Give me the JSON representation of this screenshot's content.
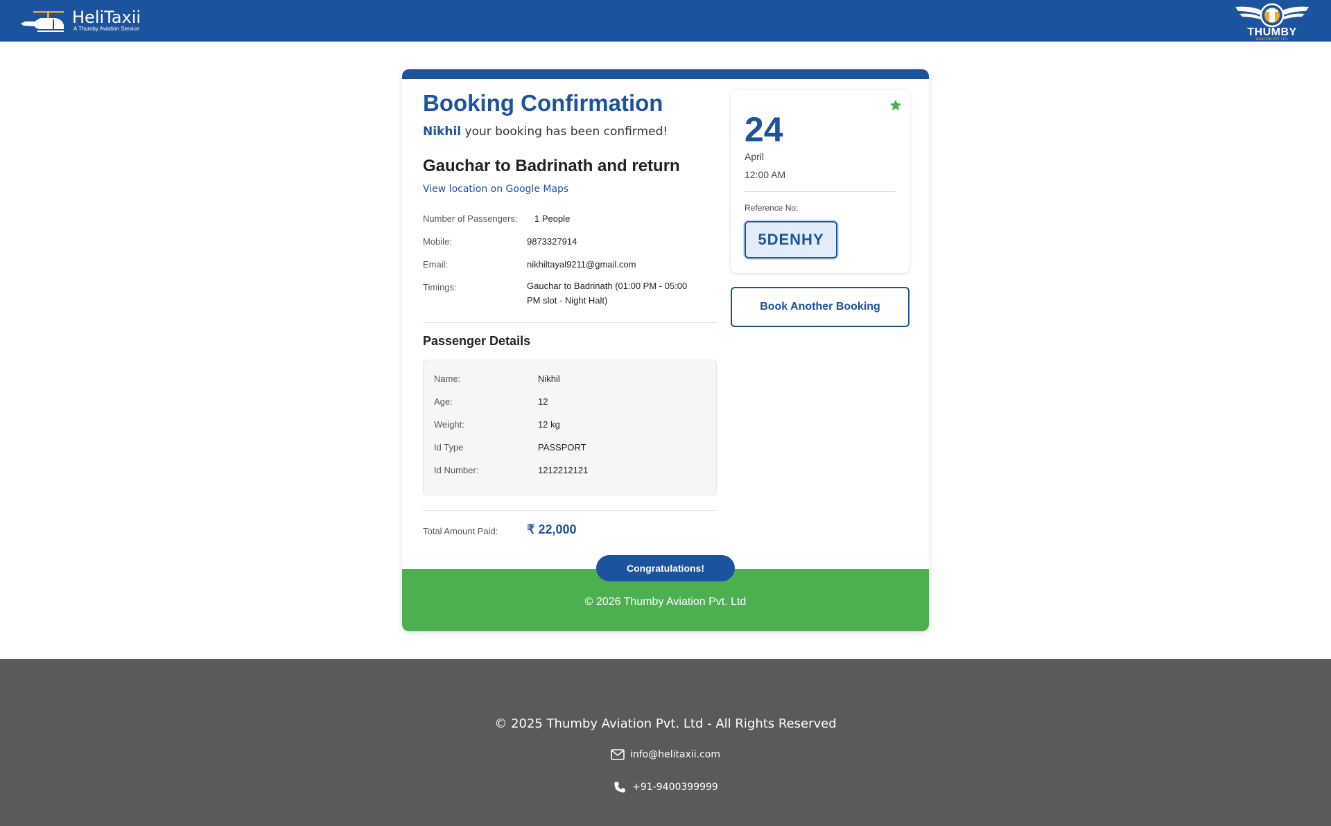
{
  "header": {
    "brand_name": "HeliTaxii",
    "brand_tagline": "A Thumby Aviation Service",
    "partner_logo_text": "THUMBY",
    "partner_logo_sub": "AVIATION PVT. LTD.",
    "bg_color": "#1c539e",
    "logo_icon": "helicopter-icon"
  },
  "booking": {
    "title": "Booking Confirmation",
    "customer_name": "Nikhil",
    "confirmation_text": " your booking has been confirmed!",
    "route": "Gauchar to Badrinath and return",
    "map_link": "View location on Google Maps",
    "details": {
      "passengers_label": "Number of Passengers:",
      "passengers_value": "1 People",
      "mobile_label": "Mobile:",
      "mobile_value": "9873327914",
      "email_label": "Email:",
      "email_value": "nikhiltayal9211@gmail.com",
      "timings_label": "Timings:",
      "timings_value": "Gauchar to Badrinath (01:00 PM - 05:00 PM slot - Night Halt)"
    },
    "passenger_details_title": "Passenger Details",
    "passenger": {
      "name_label": "Name:",
      "name_value": "Nikhil",
      "age_label": "Age:",
      "age_value": "12",
      "weight_label": "Weight:",
      "weight_value": "12 kg",
      "idtype_label": "Id Type",
      "idtype_value": "PASSPORT",
      "idnumber_label": "Id Number:",
      "idnumber_value": "1212212121"
    },
    "total_label": "Total Amount Paid:",
    "total_value": "₹ 22,000",
    "congrats_label": "Congratulations!",
    "card_copyright": "© 2026 Thumby Aviation Pvt. Ltd"
  },
  "date_panel": {
    "day": "24",
    "month": "April",
    "time": "12:00 AM",
    "ref_label": "Reference No:",
    "ref_value": "5DENHY",
    "star_icon": "star-icon",
    "star_color": "#4caf50"
  },
  "actions": {
    "book_another_label": "Book Another Booking"
  },
  "footer": {
    "copyright": "© 2025 Thumby Aviation Pvt. Ltd - All Rights Reserved",
    "email": "info@helitaxii.com",
    "phone": "+91-9400399999",
    "bg_color": "#5a5a5a"
  },
  "colors": {
    "primary": "#1c539e",
    "success": "#4caf50"
  }
}
